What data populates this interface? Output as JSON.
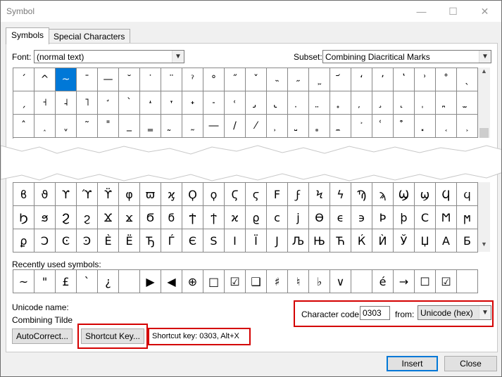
{
  "window": {
    "title": "Symbol",
    "minimize_glyph": "—",
    "maximize_glyph": "☐",
    "close_glyph": "✕"
  },
  "tabs": [
    {
      "label": "Symbols"
    },
    {
      "label": "Special Characters"
    }
  ],
  "font": {
    "label": "Font:",
    "value": "(normal text)"
  },
  "subset": {
    "label": "Subset:",
    "value": "Combining Diacritical Marks"
  },
  "top_grid_rows": [
    [
      "ˊ",
      "^",
      "~",
      "¯",
      "—",
      "˘",
      "˙",
      "¨",
      "ˀ",
      "°",
      "˝",
      "ˇ",
      "˵",
      "˶",
      "᷿",
      "᷄",
      "ʻ",
      "ʼ",
      "ʽ",
      "ʾ",
      "˚",
      "ˎ"
    ],
    [
      "ˏ",
      "˧",
      "˨",
      "˥",
      "̛",
      "ˋ",
      "˔",
      "˕",
      "˖",
      "˗",
      "˓",
      "̡",
      "̢",
      "̣",
      "̤",
      "̥",
      "̦",
      "̧",
      "̨",
      "̩",
      "̪",
      "̫"
    ],
    [
      "ˆ",
      "˰",
      "ˬ",
      "˜",
      "˭",
      "_",
      "‗",
      "̰",
      "˷",
      "―",
      "/",
      "⁄",
      "̹",
      "̺",
      "̻",
      "̼",
      "͐",
      "͑",
      "͒",
      "͓",
      "͔",
      "͕"
    ]
  ],
  "bottom_grid_rows": [
    [
      "ϐ",
      "ϑ",
      "ϒ",
      "ϓ",
      "ϔ",
      "φ",
      "ϖ",
      "ϗ",
      "Ϙ",
      "ϙ",
      "Ϛ",
      "ϛ",
      "Ϝ",
      "ϝ",
      "Ϟ",
      "ϟ",
      "Ϡ",
      "ϡ",
      "Ϣ",
      "ϣ",
      "Ϥ",
      "ϥ"
    ],
    [
      "Ϧ",
      "ϧ",
      "Ϩ",
      "ϩ",
      "Ϫ",
      "ϫ",
      "Ϭ",
      "ϭ",
      "Ϯ",
      "ϯ",
      "ϰ",
      "ϱ",
      "ϲ",
      "ϳ",
      "ϴ",
      "ϵ",
      "϶",
      "Ϸ",
      "ϸ",
      "Ϲ",
      "Ϻ",
      "ϻ"
    ],
    [
      "ϼ",
      "Ͻ",
      "Ͼ",
      "Ͽ",
      "Ѐ",
      "Ё",
      "Ђ",
      "Ѓ",
      "Є",
      "Ѕ",
      "І",
      "Ї",
      "Ј",
      "Љ",
      "Њ",
      "Ћ",
      "Ќ",
      "Ѝ",
      "Ў",
      "Џ",
      "А",
      "Б"
    ]
  ],
  "recent": {
    "label": "Recently used symbols:",
    "symbols": [
      "~",
      "\"",
      "£",
      "`",
      "¿",
      "",
      "▶",
      "◀",
      "⊕",
      "□",
      "☑",
      "❑",
      "♯",
      "♮",
      "♭",
      "∨",
      "",
      "é",
      "→",
      "☐",
      "☑",
      ""
    ]
  },
  "unicode_name": {
    "label": "Unicode name:",
    "value": "Combining Tilde"
  },
  "char_code": {
    "label": "Character code:",
    "value": "0303",
    "from_label": "from:",
    "from_value": "Unicode (hex)"
  },
  "buttons": {
    "autocorrect": "AutoCorrect...",
    "shortcut_key": "Shortcut Key...",
    "insert": "Insert",
    "close": "Close"
  },
  "shortcut_text": "Shortcut key: 0303, Alt+X",
  "colors": {
    "selection": "#0078d7",
    "highlight": "#d40000"
  }
}
